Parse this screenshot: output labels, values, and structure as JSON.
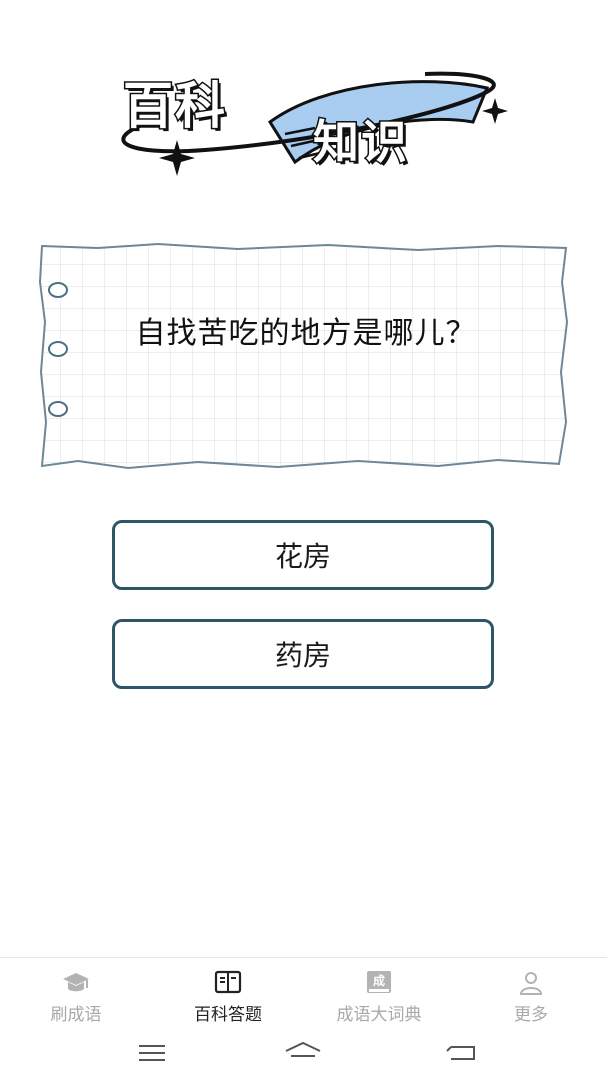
{
  "logo": {
    "line1": "百科",
    "line2": "知识",
    "colors": {
      "accent_blue": "#a9cdf0",
      "outline": "#111111"
    }
  },
  "question": {
    "text": "自找苦吃的地方是哪儿？"
  },
  "answers": [
    {
      "label": "花房"
    },
    {
      "label": "药房"
    }
  ],
  "tab_bar": {
    "tabs": [
      {
        "label": "刷成语",
        "icon": "graduation-cap-icon",
        "active": false
      },
      {
        "label": "百科答题",
        "icon": "book-icon",
        "active": true
      },
      {
        "label": "成语大词典",
        "icon": "dictionary-icon",
        "icon_char": "成",
        "active": false
      },
      {
        "label": "更多",
        "icon": "person-icon",
        "active": false
      }
    ],
    "colors": {
      "active": "#222222",
      "inactive": "#a9a9a9"
    }
  },
  "system_nav": {
    "buttons": [
      "menu-icon",
      "home-icon",
      "back-icon"
    ]
  },
  "colors": {
    "button_border": "#2f5668",
    "paper_grid": "#d9dde2",
    "paper_edge": "#6f8796"
  }
}
